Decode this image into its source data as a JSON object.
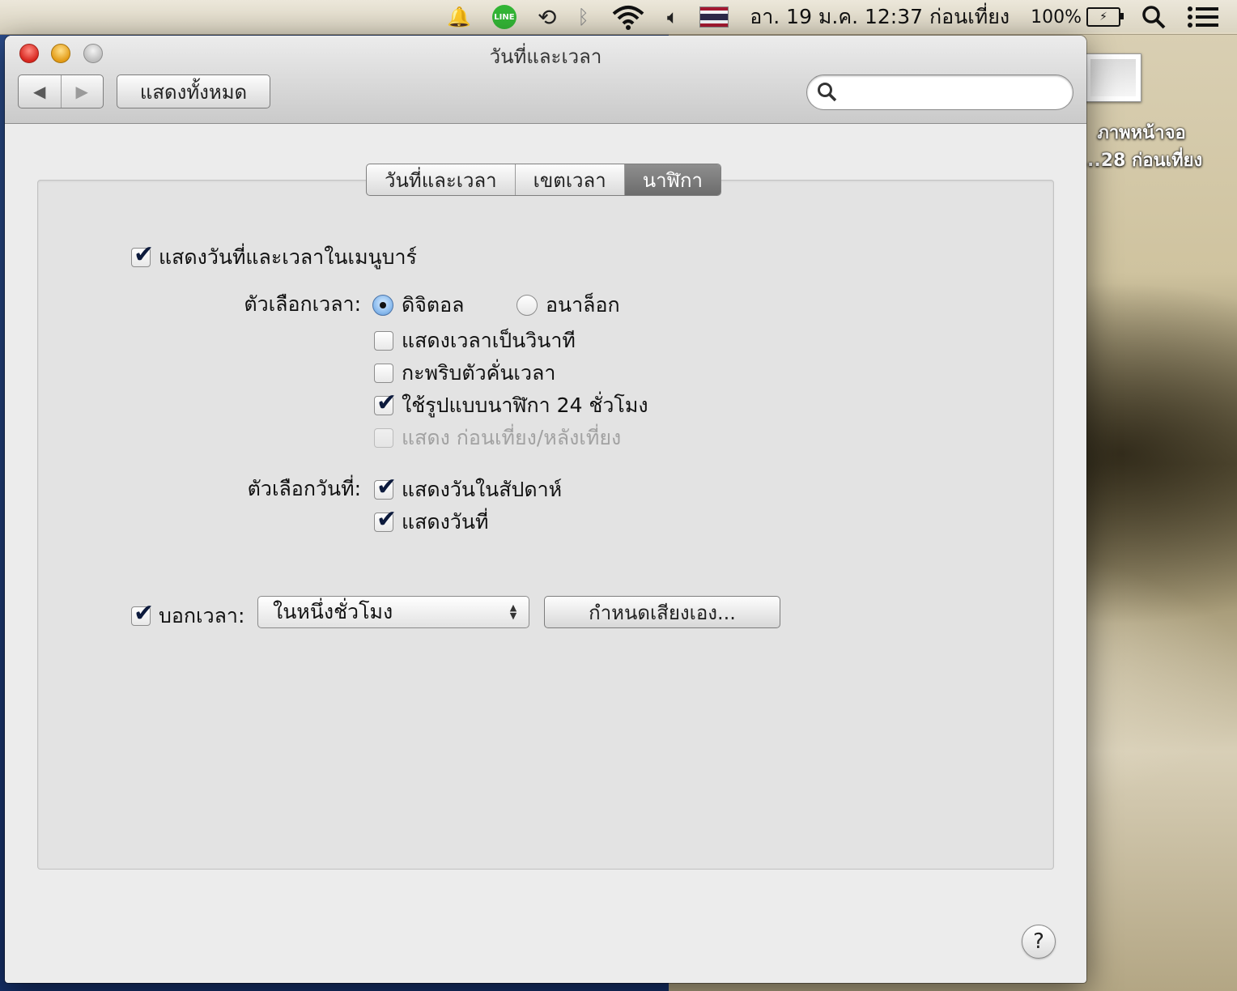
{
  "menubar": {
    "line_label": "LINE",
    "datetime": "อา. 19 ม.ค.  12:37 ก่อนเที่ยง",
    "battery": "100%",
    "flag_colors": [
      "#a51931",
      "#f4f5f8",
      "#2d2a4a",
      "#f4f5f8",
      "#a51931"
    ]
  },
  "desktop": {
    "file_label_line1": "ภาพหน้าจอ",
    "file_label_line2": "...28 ก่อนเที่ยง"
  },
  "window": {
    "title": "วันที่และเวลา",
    "show_all": "แสดงทั้งหมด",
    "search_placeholder": ""
  },
  "tabs": [
    {
      "label": "วันที่และเวลา",
      "selected": false
    },
    {
      "label": "เขตเวลา",
      "selected": false
    },
    {
      "label": "นาฬิกา",
      "selected": true
    }
  ],
  "clock": {
    "show_in_menubar": {
      "label": "แสดงวันที่และเวลาในเมนูบาร์",
      "checked": true
    },
    "time_options_label": "ตัวเลือกเวลา:",
    "digital": {
      "label": "ดิจิตอล",
      "selected": true
    },
    "analog": {
      "label": "อนาล็อก",
      "selected": false
    },
    "show_seconds": {
      "label": "แสดงเวลาเป็นวินาที",
      "checked": false
    },
    "flash_separators": {
      "label": "กะพริบตัวคั่นเวลา",
      "checked": false
    },
    "use_24h": {
      "label": "ใช้รูปแบบนาฬิกา 24 ชั่วโมง",
      "checked": true
    },
    "show_ampm": {
      "label": "แสดง ก่อนเที่ยง/หลังเที่ยง",
      "checked": false,
      "disabled": true
    },
    "date_options_label": "ตัวเลือกวันที่:",
    "show_weekday": {
      "label": "แสดงวันในสัปดาห์",
      "checked": true
    },
    "show_date": {
      "label": "แสดงวันที่",
      "checked": true
    },
    "announce_time": {
      "label": "บอกเวลา:",
      "checked": true
    },
    "announce_interval": "ในหนึ่งชั่วโมง",
    "customize_voice": "กำหนดเสียงเอง..."
  },
  "help_label": "?"
}
